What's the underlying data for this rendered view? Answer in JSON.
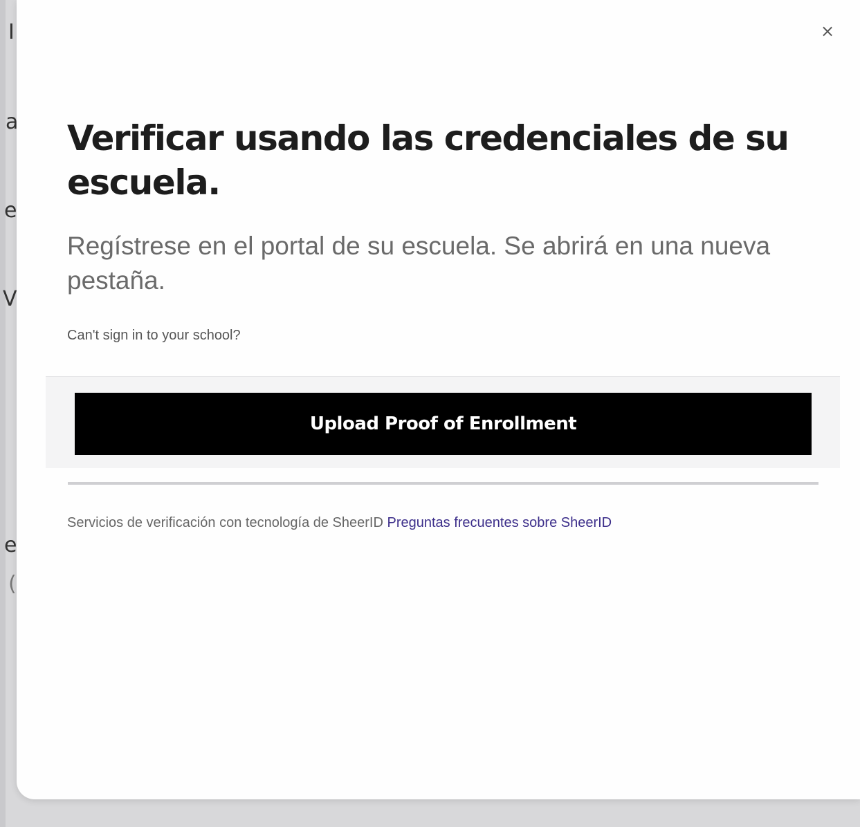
{
  "backdrop": {
    "fragments": [
      "I",
      "a",
      "e",
      "V",
      "e",
      "("
    ]
  },
  "modal": {
    "close_glyph": "×",
    "title": "Verificar usando las credenciales de su escuela.",
    "subtitle": "Regístrese en el portal de su escuela. Se abrirá en una nueva pestaña.",
    "cant_sign_in_link": "Can't sign in to your school?",
    "upload_button_label": "Upload Proof of Enrollment",
    "footer_text": "Servicios de verificación con tecnología de SheerID",
    "footer_link": "Preguntas frecuentes sobre SheerID",
    "footer_link_color": "#3c2e8a",
    "button_color": "#000000"
  }
}
